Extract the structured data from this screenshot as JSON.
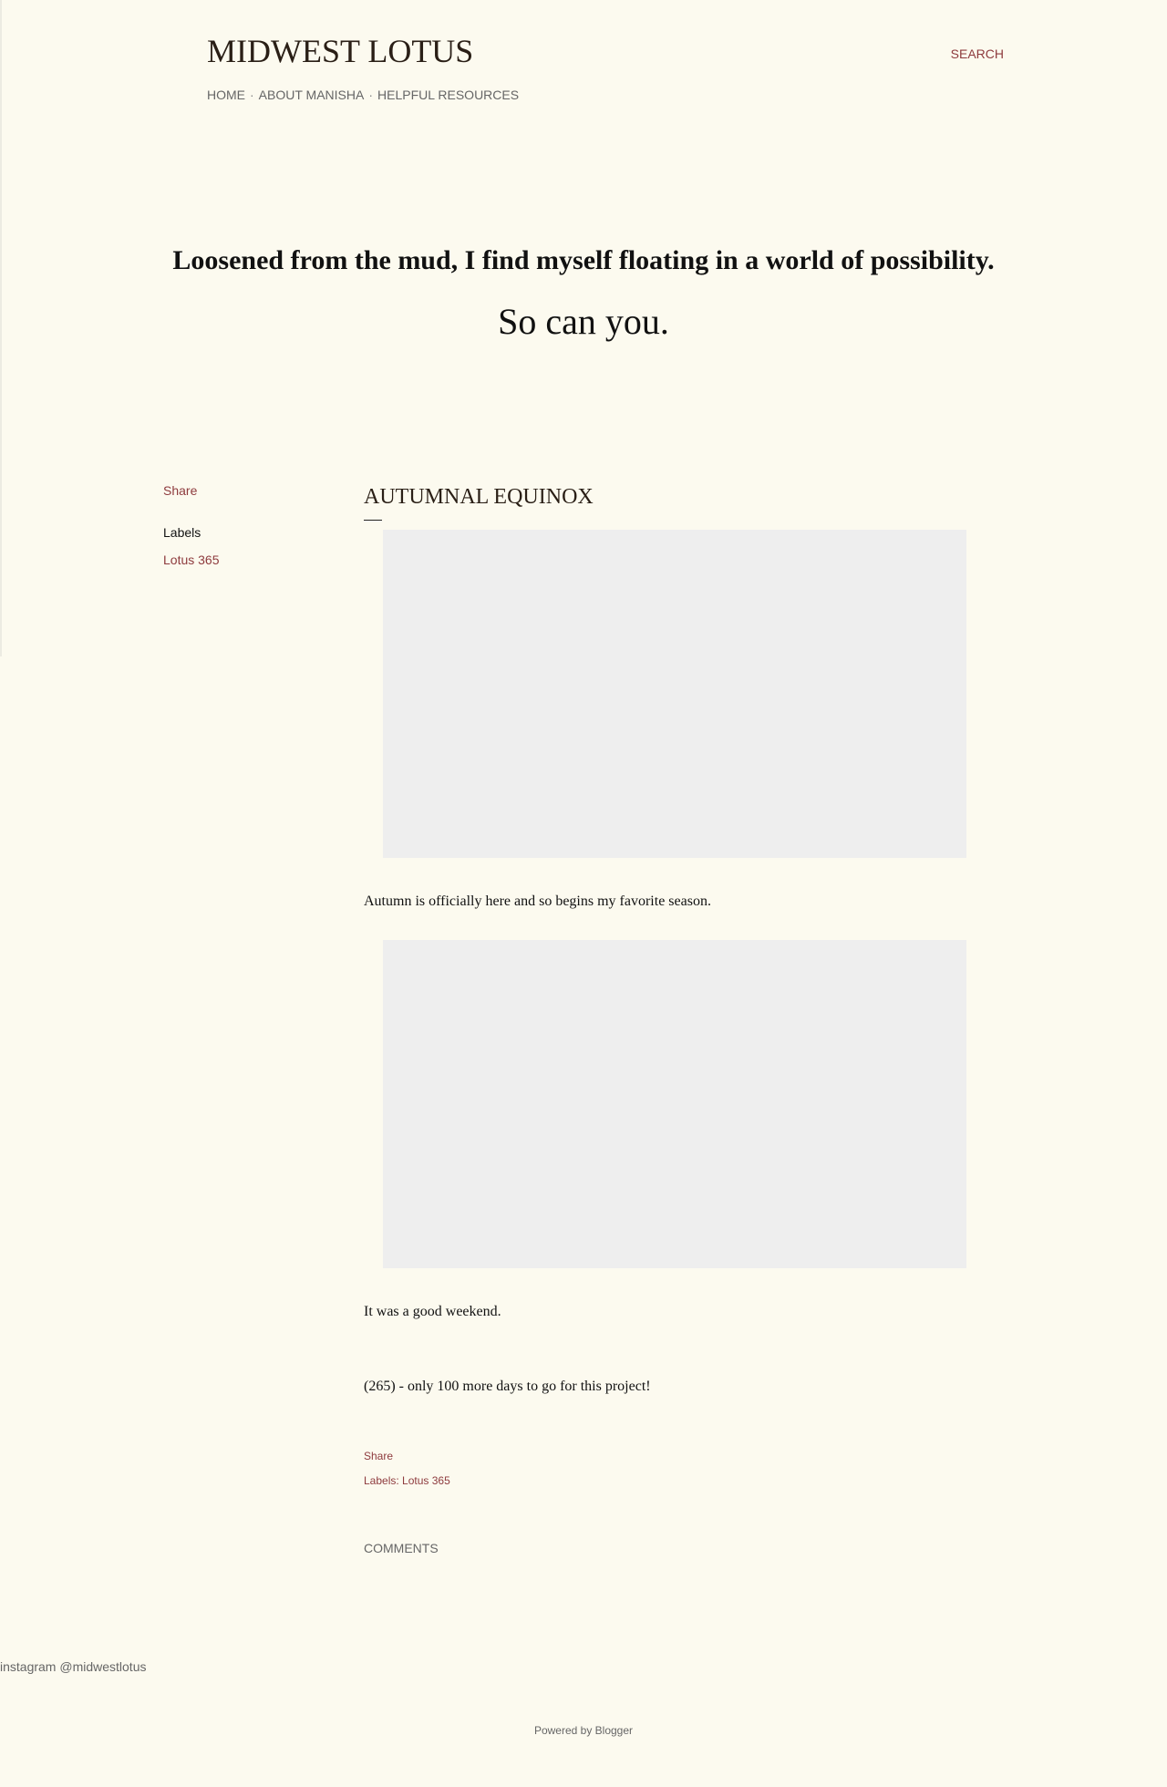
{
  "header": {
    "site_title": "MIDWEST LOTUS",
    "search_label": "SEARCH",
    "nav": {
      "items": [
        "HOME",
        "ABOUT MANISHA",
        "HELPFUL RESOURCES"
      ],
      "separator": "·"
    }
  },
  "hero": {
    "tagline": "Loosened from the mud, I find myself floating in a world of possibility.",
    "subtagline": "So can you."
  },
  "sidebar": {
    "share_label": "Share",
    "labels_heading": "Labels",
    "labels": [
      "Lotus 365"
    ]
  },
  "post": {
    "title": "AUTUMNAL EQUINOX",
    "paragraphs": [
      "Autumn is officially here and so begins my favorite season.",
      "It was a good weekend.",
      "(265) - only 100 more days to go for this project!"
    ],
    "share_label": "Share",
    "labels_prefix": "Labels:",
    "labels": [
      "Lotus 365"
    ]
  },
  "comments": {
    "heading": "COMMENTS"
  },
  "footer": {
    "instagram_text": "instagram @midwestlotus",
    "powered_by": "Powered by Blogger"
  },
  "colors": {
    "background": "#fcfaef",
    "link_accent": "#8e3b3e",
    "image_placeholder": "#eeeeee"
  }
}
